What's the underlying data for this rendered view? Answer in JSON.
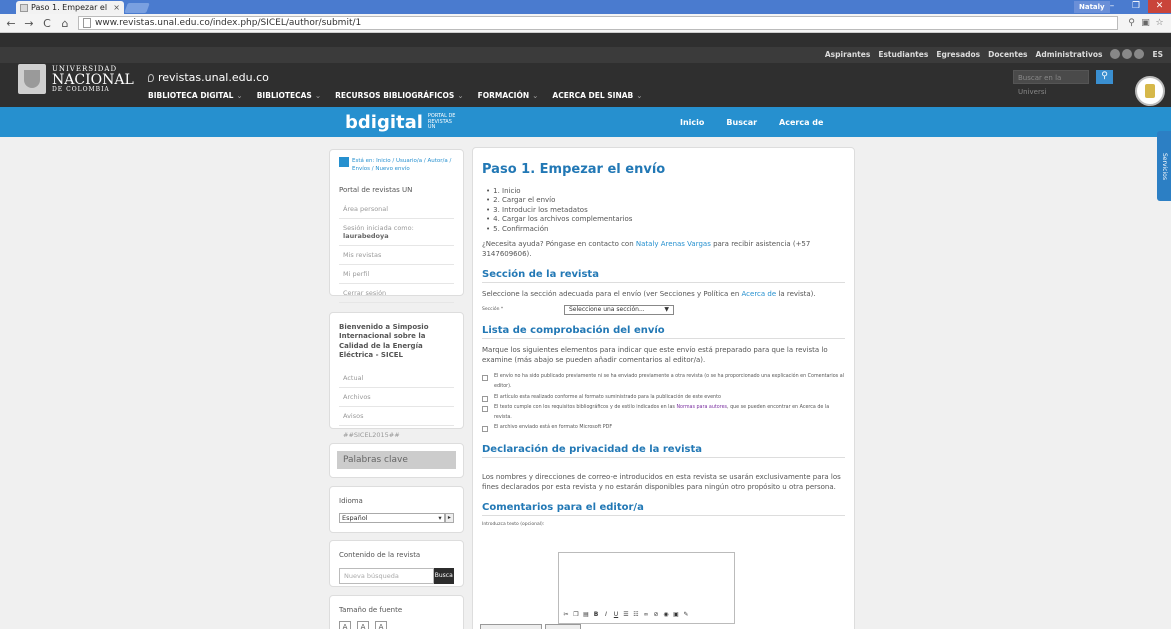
{
  "browser": {
    "tab_title": "Paso 1. Empezar el e",
    "tab_close": "×",
    "user": "Nataly",
    "url": "www.revistas.unal.edu.co/index.php/SICEL/author/submit/1"
  },
  "site": {
    "toplinks": [
      "Aspirantes",
      "Estudiantes",
      "Egresados",
      "Docentes",
      "Administrativos"
    ],
    "lang": "ES",
    "logo": {
      "l1": "UNIVERSIDAD",
      "l2": "NACIONAL",
      "l3": "DE COLOMBIA"
    },
    "title": "revistas.unal.edu.co",
    "menu": [
      "BIBLIOTECA DIGITAL",
      "BIBLIOTECAS",
      "RECURSOS BIBLIOGRÁFICOS",
      "FORMACIÓN",
      "ACERCA DEL SINAB"
    ],
    "search_placeholder": "Buscar en la Universi"
  },
  "bluebar": {
    "logo": "bdigital",
    "logo_sub": "PORTAL DE REVISTAS UN",
    "nav": [
      "Inicio",
      "Buscar",
      "Acerca de"
    ],
    "services_tab": "Servicios"
  },
  "sidebar": {
    "breadcrumb": "Está en: Inicio / Usuario/a / Autor/a / Envíos / Nuevo envío",
    "portal": "Portal de revistas UN",
    "personal": "Área personal",
    "session_label": "Sesión iniciada como: ",
    "session_user": "laurabedoya",
    "user_items": [
      "Mis revistas",
      "Mi perfil",
      "Cerrar sesión"
    ],
    "welcome": "Bienvenido a Simposio Internacional sobre la Calidad de la Energía Eléctrica - SICEL",
    "journal_items": [
      "Actual",
      "Archivos",
      "Avisos",
      "##SICEL2015##"
    ],
    "keywords": "Palabras clave",
    "idioma_label": "Idioma",
    "idioma_value": "Español",
    "contenido_label": "Contenido de la revista",
    "search_placeholder": "Nueva búsqueda",
    "search_button": "Busca",
    "font_label": "Tamaño de fuente"
  },
  "main": {
    "title": "Paso 1. Empezar el envío",
    "steps": [
      "1. Inicio",
      "2. Cargar el envío",
      "3. Introducir los metadatos",
      "4. Cargar los archivos complementarios",
      "5. Confirmación"
    ],
    "help_pre": "¿Necesita ayuda? Póngase en contacto con ",
    "help_name": "Nataly Arenas Vargas",
    "help_post": " para recibir asistencia (+57 3147609606).",
    "sec_title": "Sección de la revista",
    "sec_text_pre": "Seleccione la sección adecuada para el envío (ver Secciones y Política en ",
    "sec_text_link": "Acerca de",
    "sec_text_post": " la revista).",
    "sec_label": "Sección *",
    "sec_select": "Seleccione una sección...",
    "check_title": "Lista de comprobación del envío",
    "check_text": "Marque los siguientes elementos para indicar que este envío está preparado para que la revista lo examine (más abajo se pueden añadir comentarios al editor/a).",
    "checks": [
      "El envío no ha sido publicado previamente ni se ha enviado previamente a otra revista (o se ha proporcionado una explicación en Comentarios al editor).",
      "El artículo esta realizado conforme al formato suministrado para la publicación de este evento",
      "El archivo enviado está en formato Microsoft PDF"
    ],
    "check3_pre": "El texto cumple con los requisitos bibliográficos y de estilo indicados en las ",
    "check3_link": "Normas para autores",
    "check3_post": ", que se pueden encontrar en Acerca de la revista.",
    "privacy_title": "Declaración de privacidad de la revista",
    "privacy_text": "Los nombres y direcciones de correo-e introducidos en esta revista se usarán exclusivamente para los fines declarados por esta revista y no estarán disponibles para ningún otro propósito u otra persona.",
    "comments_title": "Comentarios para el editor/a",
    "editor_label": "Introduzca texto (opcional):"
  }
}
